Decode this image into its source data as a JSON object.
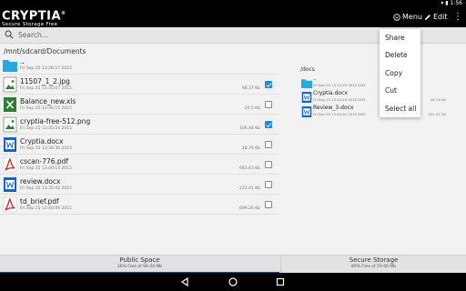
{
  "status_bar": {
    "time": "1:56"
  },
  "app_bar": {
    "logo_name": "CRYPTIA",
    "logo_reg": "®",
    "logo_sub": "Secure Storage Free",
    "menu_label": "Menu",
    "edit_label": "Edit"
  },
  "search": {
    "placeholder": "Search..."
  },
  "left_pane": {
    "path": "/mnt/sdcard/Documents",
    "rows": [
      {
        "name": "..",
        "date": "Fri Sep 25 13:28:17 2015",
        "size": "",
        "type": "folder",
        "checked": null
      },
      {
        "name": "11507_1_2.jpg",
        "date": "Fri Sep 25 13:35:07 2015",
        "size": "98.37 Kb",
        "type": "image",
        "checked": true
      },
      {
        "name": "Balance_new.xls",
        "date": "Fri Sep 25 13:36:15 2015",
        "size": "20.5 Kb",
        "type": "excel",
        "checked": false
      },
      {
        "name": "cryptia-free-512.png",
        "date": "Fri Sep 25 13:35:54 2015",
        "size": "106.48 Kb",
        "type": "image",
        "checked": true
      },
      {
        "name": "Cryptia.docx",
        "date": "Fri Sep 25 13:36:30 2015",
        "size": "28.76 Kb",
        "type": "word",
        "checked": false
      },
      {
        "name": "cscan-776.pdf",
        "date": "Fri Sep 25 13:40:14 2015",
        "size": "683.63 Kb",
        "type": "pdf",
        "checked": false
      },
      {
        "name": "review.docx",
        "date": "Fri Sep 25 13:35:42 2015",
        "size": "231.41 Kb",
        "type": "word",
        "checked": false
      },
      {
        "name": "td_brief.pdf",
        "date": "Fri Sep 25 13:40:09 2015",
        "size": "699.26 Kb",
        "type": "pdf",
        "checked": false
      }
    ]
  },
  "right_pane": {
    "path": "/docs",
    "rows": [
      {
        "name": "..",
        "date": "Fri Sep 25 13:24:45 2015 GMT",
        "size": "",
        "type": "folder"
      },
      {
        "name": "Cryptia.docx",
        "date": "Fri Sep 25 13:44:19 2015 GMT",
        "size": "28.76 Kb",
        "type": "word"
      },
      {
        "name": "Review_3.docx",
        "date": "Fri Sep 25 13:44:24 2015 GMT",
        "size": "231.41 Kb",
        "type": "word"
      }
    ]
  },
  "popup_menu": {
    "items": [
      "Share",
      "Delete",
      "Copy",
      "Cut",
      "Select all"
    ]
  },
  "bottom_tabs": {
    "public": {
      "title": "Public Space",
      "subtitle": "26% Free of 98.44 Mb"
    },
    "secure": {
      "title": "Secure Storage",
      "subtitle": "89% Free of 19.66 Mb"
    }
  },
  "colors": {
    "accent": "#1e88e5",
    "excel": "#2e7d32",
    "word": "#1565c0",
    "pdf": "#d32f2f",
    "folder": "#29a8e0"
  }
}
